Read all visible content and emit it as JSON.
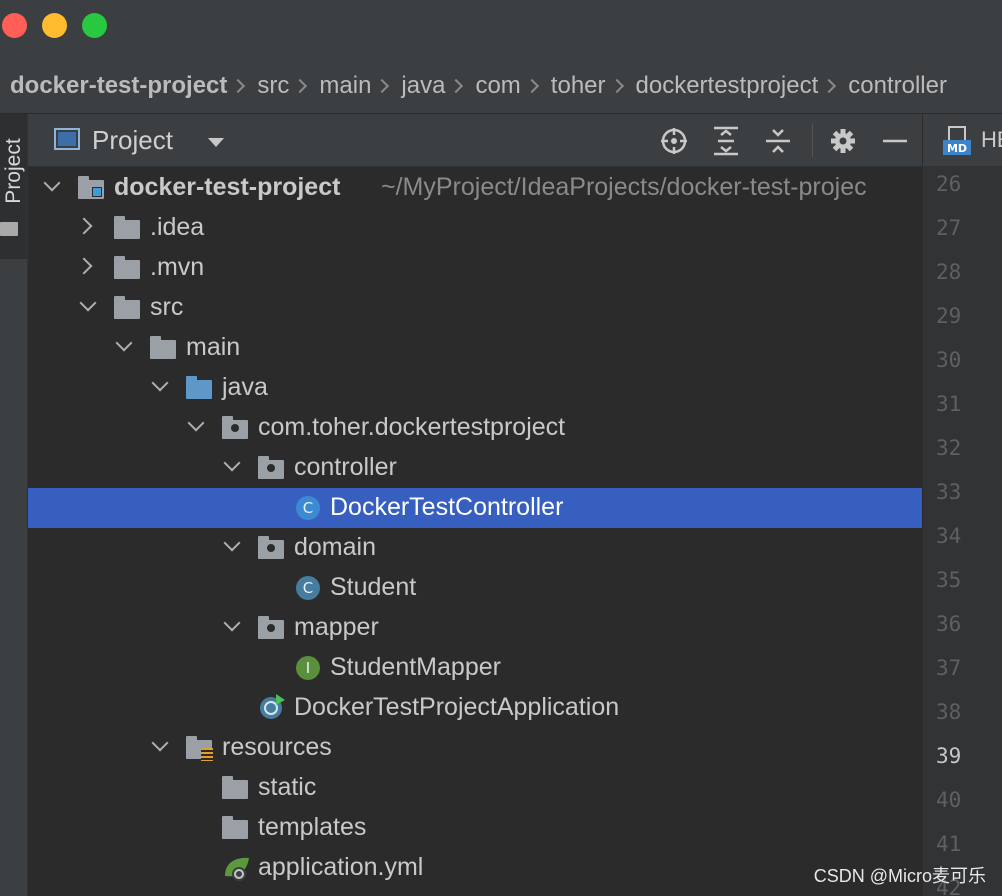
{
  "breadcrumb": [
    "docker-test-project",
    "src",
    "main",
    "java",
    "com",
    "toher",
    "dockertestproject",
    "controller"
  ],
  "toolstripe": {
    "label": "Project"
  },
  "project_panel": {
    "title": "Project"
  },
  "tree": {
    "root": {
      "label": "docker-test-project",
      "path": "~/MyProject/IdeaProjects/docker-test-projec"
    },
    "items": [
      ".idea",
      ".mvn",
      "src",
      "main",
      "java",
      "com.toher.dockertestproject",
      "controller",
      "DockerTestController",
      "domain",
      "Student",
      "mapper",
      "StudentMapper",
      "DockerTestProjectApplication",
      "resources",
      "static",
      "templates",
      "application.yml"
    ],
    "class_badge": "C",
    "interface_badge": "I"
  },
  "editor": {
    "tab_label": "HE",
    "md_badge": "MD",
    "line_numbers": [
      "26",
      "27",
      "28",
      "29",
      "30",
      "31",
      "32",
      "33",
      "34",
      "35",
      "36",
      "37",
      "38",
      "39",
      "40",
      "41",
      "42"
    ],
    "current_line": "39"
  },
  "watermark": "CSDN @Micro麦可乐",
  "colors": {
    "selection": "#375fbf",
    "background": "#2b2b2b",
    "panel": "#3c3f41"
  }
}
